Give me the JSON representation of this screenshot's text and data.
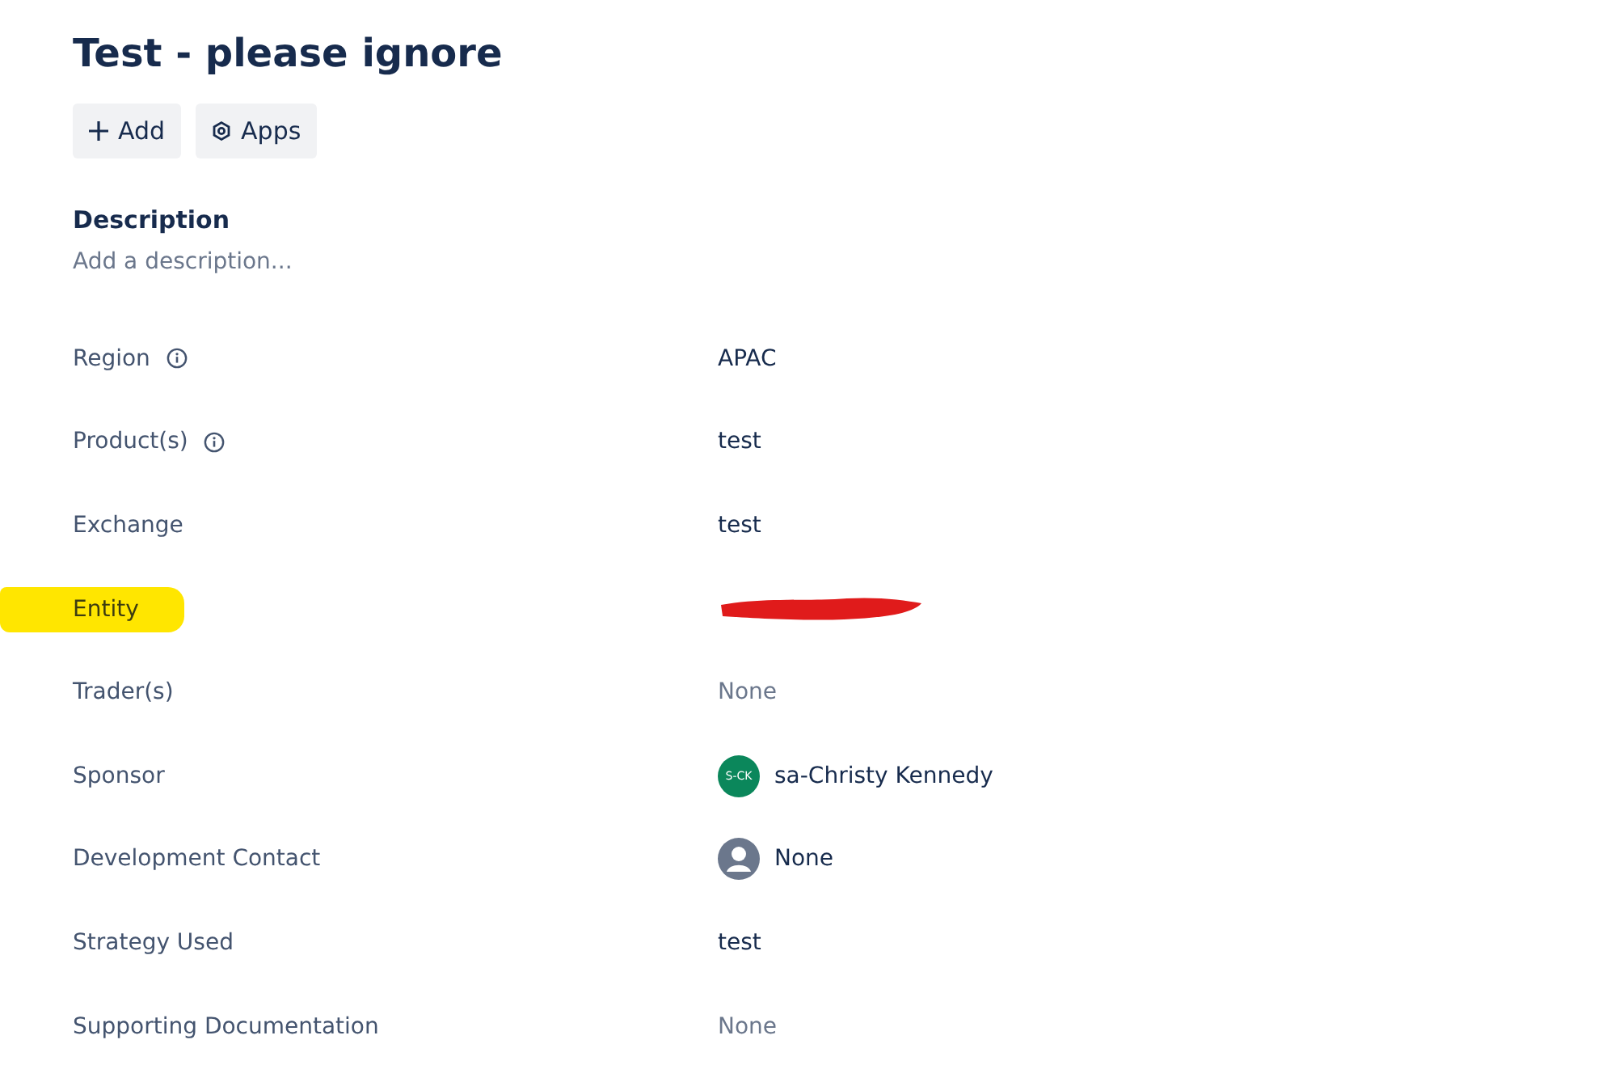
{
  "title": "Test - please ignore",
  "actions": [
    {
      "label": "Add"
    },
    {
      "label": "Apps"
    }
  ],
  "description": {
    "heading": "Description",
    "placeholder": "Add a description..."
  },
  "fields": [
    {
      "label": "Region",
      "info": true,
      "highlighted": false,
      "kind": "text",
      "value": "APAC"
    },
    {
      "label": "Product(s)",
      "info": true,
      "highlighted": false,
      "kind": "text",
      "value": "test"
    },
    {
      "label": "Exchange",
      "info": false,
      "highlighted": false,
      "kind": "text",
      "value": "test"
    },
    {
      "label": "Entity",
      "info": false,
      "highlighted": true,
      "kind": "redacted"
    },
    {
      "label": "Trader(s)",
      "info": false,
      "highlighted": false,
      "kind": "empty",
      "value": "None"
    },
    {
      "label": "Sponsor",
      "info": false,
      "highlighted": false,
      "kind": "user",
      "initials": "S-CK",
      "color": "#0b875b",
      "value": "sa-Christy Kennedy"
    },
    {
      "label": "Development Contact",
      "info": false,
      "highlighted": false,
      "kind": "unassigned",
      "value": "None"
    },
    {
      "label": "Strategy Used",
      "info": false,
      "highlighted": false,
      "kind": "text",
      "value": "test"
    },
    {
      "label": "Supporting Documentation",
      "info": false,
      "highlighted": false,
      "kind": "empty",
      "value": "None"
    }
  ]
}
